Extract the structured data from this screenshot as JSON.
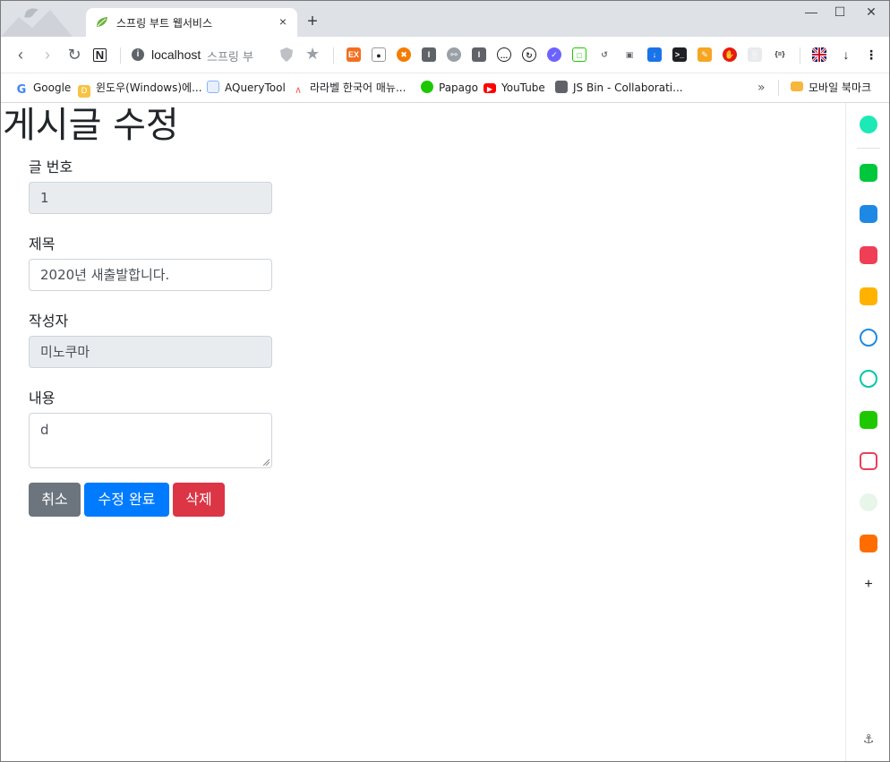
{
  "browser": {
    "tab_title": "스프링 부트 웹서비스",
    "tab_close": "×",
    "new_tab": "+",
    "window_min": "—",
    "window_max": "☐",
    "window_close": "✕",
    "address_host": "localhost",
    "address_title": "스프링 부",
    "info_glyph": "i"
  },
  "bookmarks": [
    {
      "label": "Google",
      "icon": "google-icon",
      "color": "#ffffff"
    },
    {
      "label": "윈도우(Windows)에...",
      "icon": "bookmark-d-icon",
      "color": "#f6c344"
    },
    {
      "label": "AQueryTool",
      "icon": "document-icon",
      "color": "#8ab4f8"
    },
    {
      "label": "라라벨 한국어 매뉴...",
      "icon": "laravel-icon",
      "color": "#f4645f"
    },
    {
      "label": "Papago",
      "icon": "papago-icon",
      "color": "#1ec800"
    },
    {
      "label": "YouTube",
      "icon": "youtube-icon",
      "color": "#ff0000"
    },
    {
      "label": "JS Bin - Collaborati...",
      "icon": "jsbin-icon",
      "color": "#5f6368"
    },
    {
      "label": "모바일 북마크",
      "icon": "folder-icon",
      "color": "#f6b73c"
    }
  ],
  "page": {
    "heading": "게시글 수정",
    "fields": {
      "id_label": "글 번호",
      "id_value": "1",
      "title_label": "제목",
      "title_value": "2020년 새출발합니다.",
      "author_label": "작성자",
      "author_value": "미노쿠마",
      "content_label": "내용",
      "content_value": "d"
    },
    "buttons": {
      "cancel": "취소",
      "save": "수정 완료",
      "delete": "삭제"
    }
  },
  "colors": {
    "cancel": "#6c757d",
    "save": "#007bff",
    "delete": "#dc3545"
  }
}
